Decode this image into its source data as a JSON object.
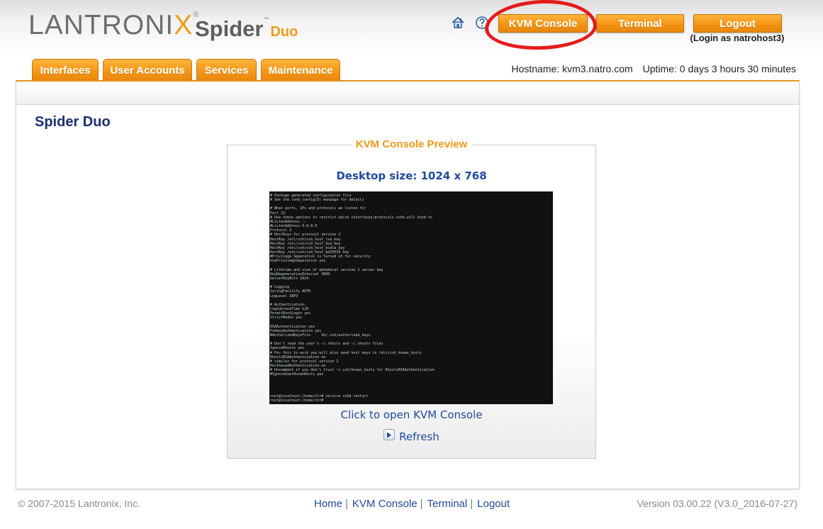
{
  "header": {
    "logo_main": "LANTRONI",
    "logo_main_x": "X",
    "logo_registered": "®",
    "logo_product": "Spider",
    "logo_product_suffix": "Duo",
    "logo_tm": "™",
    "home_icon": "home-icon",
    "help_icon": "help-icon",
    "buttons": {
      "kvm_console": "KVM Console",
      "terminal": "Terminal",
      "logout": "Logout"
    },
    "login_as": "(Login as natrohost3)"
  },
  "nav": {
    "tabs": [
      {
        "label": "Interfaces"
      },
      {
        "label": "User Accounts"
      },
      {
        "label": "Services"
      },
      {
        "label": "Maintenance"
      }
    ],
    "hostname": "Hostname: kvm3.natro.com",
    "uptime": "Uptime: 0 days 3 hours 30 minutes"
  },
  "main": {
    "title": "Spider Duo",
    "preview": {
      "legend": "KVM Console Preview",
      "desktop_size": "Desktop size: 1024 x 768",
      "screen_text": "# Package generated configuration file\n# See the sshd_config(5) manpage for details\n\n# What ports, IPs and protocols we listen for\nPort 22\n# Use these options to restrict which interfaces/protocols sshd will bind to\n#ListenAddress ::\n#ListenAddress 0.0.0.0\nProtocol 2\n# HostKeys for protocol version 2\nHostKey /etc/ssh/ssh_host_rsa_key\nHostKey /etc/ssh/ssh_host_dsa_key\nHostKey /etc/ssh/ssh_host_ecdsa_key\nHostKey /etc/ssh/ssh_host_ed25519_key\n#Privilege Separation is turned on for security\nUsePrivilegeSeparation yes\n\n# Lifetime and size of ephemeral version 1 server key\nKeyRegenerationInterval 3600\nServerKeyBits 1024\n\n# Logging\nSyslogFacility AUTH\nLogLevel INFO\n\n# Authentication:\nLoginGraceTime 120\nPermitRootLogin yes\nStrictModes yes\n\nRSAAuthentication yes\nPubkeyAuthentication yes\n#AuthorizedKeysFile     %h/.ssh/authorized_keys\n\n# Don't read the user's ~/.rhosts and ~/.shosts files\nIgnoreRhosts yes\n# For this to work you will also need host keys in /etc/ssh_known_hosts\nRhostsRSAAuthentication no\n# similar for protocol version 2\nHostbasedAuthentication no\n# Uncomment if you don't trust ~/.ssh/known_hosts for RhostsRSAAuthentication\n#IgnoreUserKnownHosts yes\n\n\n\n\nroot@localhost:/home/ntr# service sshd restart\nroot@localhost:/home/ntr#",
      "open_link": "Click to open KVM Console",
      "refresh": "Refresh"
    }
  },
  "footer": {
    "copyright": "© 2007-2015 Lantronix, Inc.",
    "links": [
      "Home",
      "KVM Console",
      "Terminal",
      "Logout"
    ],
    "separator": "|",
    "version": "Version 03.00.22 (V3.0_2016-07-27)"
  },
  "colors": {
    "accent_orange": "#f39414",
    "title_blue": "#1c2f6e",
    "link_blue": "#1f4a9c",
    "annotation_red": "#e51b1b"
  }
}
